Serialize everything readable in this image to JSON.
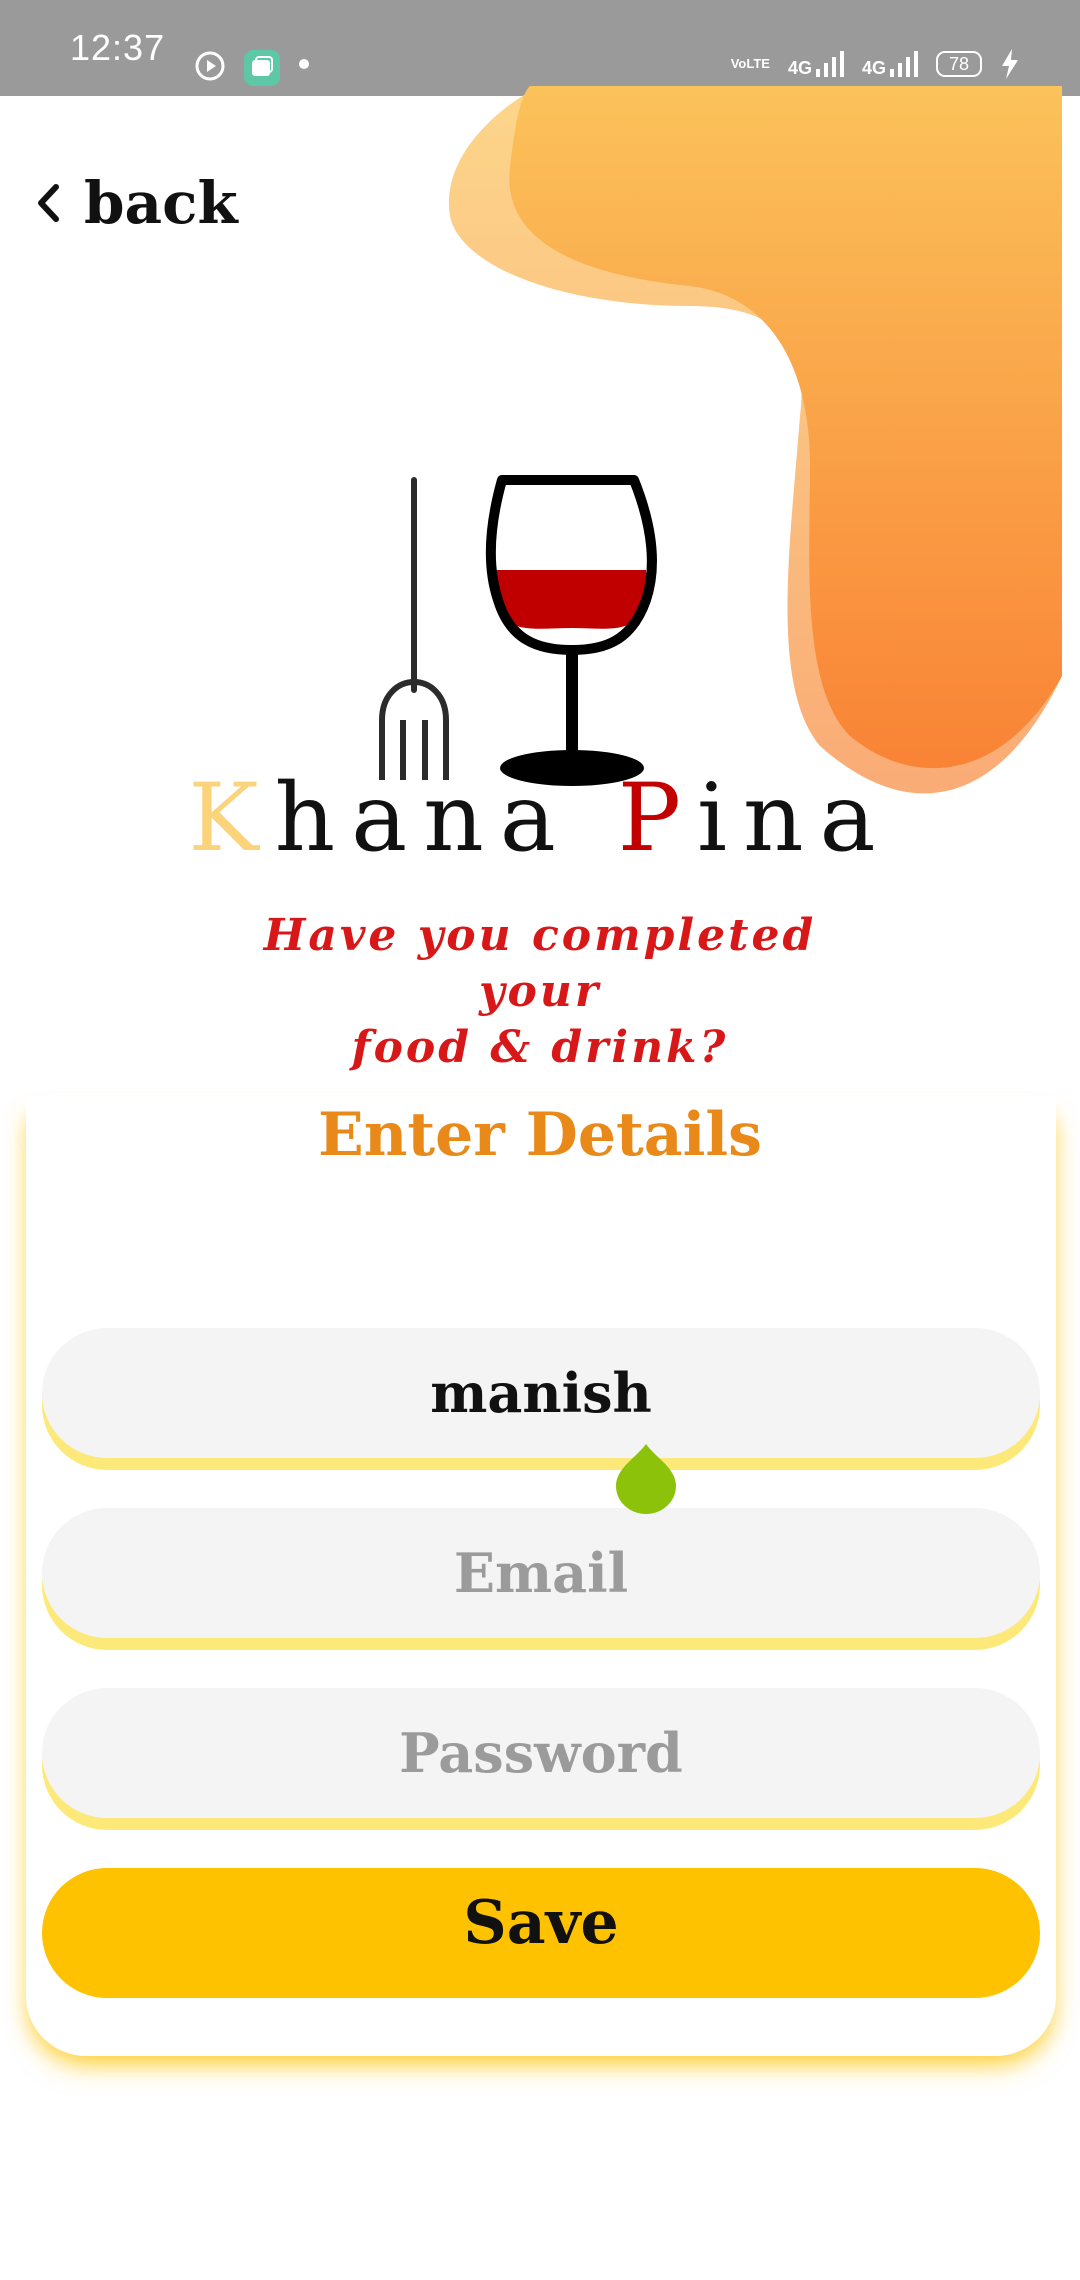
{
  "status_bar": {
    "time": "12:37",
    "network_1": "4G",
    "network_2": "4G",
    "volte": "VoLTE",
    "battery": "78"
  },
  "header": {
    "back_label": "back"
  },
  "logo": {
    "brand_k": "K",
    "brand_rest_1": "hana ",
    "brand_p": "P",
    "brand_rest_2": "ina",
    "tagline_line1": "Have you completed your",
    "tagline_line2": "food & drink?"
  },
  "form": {
    "title": "Enter Details",
    "name_value": "manish",
    "email_placeholder": "Email",
    "password_placeholder": "Password",
    "save_label": "Save"
  },
  "colors": {
    "accent_orange": "#e8891a",
    "button_yellow": "#fec200",
    "field_underline": "#fde97a",
    "tagline_red": "#d81818"
  }
}
